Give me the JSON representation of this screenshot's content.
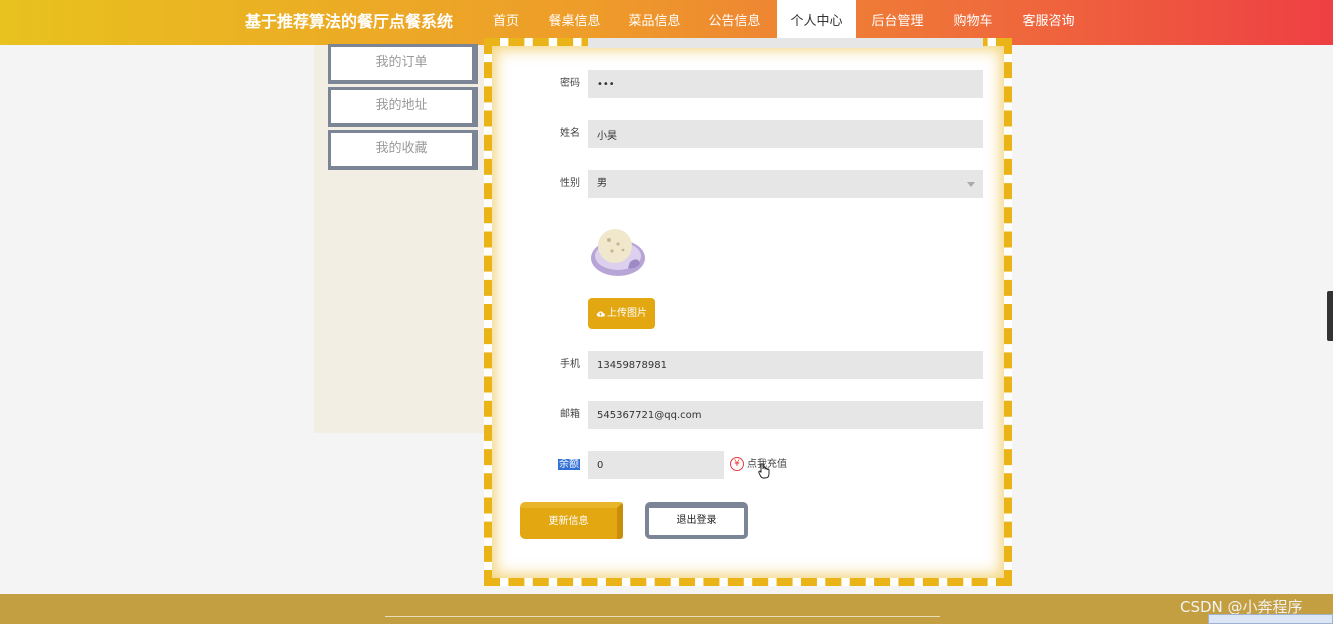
{
  "header": {
    "site_title": "基于推荐算法的餐厅点餐系统",
    "nav": [
      {
        "label": "首页"
      },
      {
        "label": "餐桌信息"
      },
      {
        "label": "菜品信息"
      },
      {
        "label": "公告信息"
      },
      {
        "label": "个人中心",
        "active": true
      },
      {
        "label": "后台管理"
      },
      {
        "label": "购物车"
      },
      {
        "label": "客服咨询"
      }
    ]
  },
  "sidebar": {
    "items": [
      {
        "label": "我的订单"
      },
      {
        "label": "我的地址"
      },
      {
        "label": "我的收藏"
      }
    ]
  },
  "form": {
    "password": {
      "label": "密码",
      "value": "•••"
    },
    "name": {
      "label": "姓名",
      "value": "小昊"
    },
    "gender": {
      "label": "性别",
      "value": "男"
    },
    "upload_label": "上传图片",
    "phone": {
      "label": "手机",
      "value": "13459878981"
    },
    "email": {
      "label": "邮箱",
      "value": "545367721@qq.com"
    },
    "balance": {
      "label": "余额",
      "value": "0"
    },
    "recharge_label": "点我充值",
    "update_button": "更新信息",
    "logout_button": "退出登录"
  },
  "footer": {
    "watermark": "CSDN @小奔程序"
  },
  "colors": {
    "accent": "#e3a712",
    "border_dashed": "#eab318",
    "sidebar_border": "#7c8596",
    "footer": "#c49f42"
  },
  "icons": [
    "cloud-upload-icon",
    "yuan-icon",
    "hand-cursor-icon",
    "dropdown-arrow-icon"
  ]
}
